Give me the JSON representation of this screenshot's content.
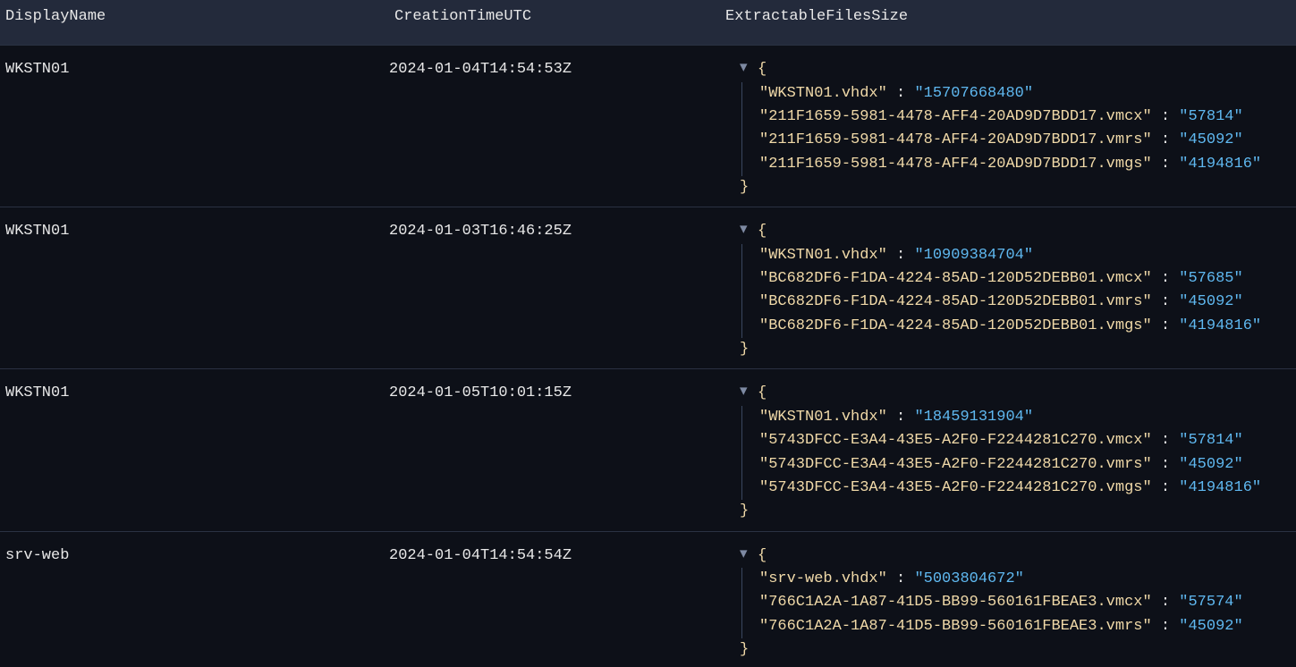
{
  "columns": {
    "displayName": "DisplayName",
    "creationTime": "CreationTimeUTC",
    "extractable": "ExtractableFilesSize"
  },
  "rows": [
    {
      "displayName": "WKSTN01",
      "creationTime": "2024-01-04T14:54:53Z",
      "files": [
        {
          "k": "WKSTN01.vhdx",
          "v": "15707668480"
        },
        {
          "k": "211F1659-5981-4478-AFF4-20AD9D7BDD17.vmcx",
          "v": "57814"
        },
        {
          "k": "211F1659-5981-4478-AFF4-20AD9D7BDD17.vmrs",
          "v": "45092"
        },
        {
          "k": "211F1659-5981-4478-AFF4-20AD9D7BDD17.vmgs",
          "v": "4194816"
        }
      ]
    },
    {
      "displayName": "WKSTN01",
      "creationTime": "2024-01-03T16:46:25Z",
      "files": [
        {
          "k": "WKSTN01.vhdx",
          "v": "10909384704"
        },
        {
          "k": "BC682DF6-F1DA-4224-85AD-120D52DEBB01.vmcx",
          "v": "57685"
        },
        {
          "k": "BC682DF6-F1DA-4224-85AD-120D52DEBB01.vmrs",
          "v": "45092"
        },
        {
          "k": "BC682DF6-F1DA-4224-85AD-120D52DEBB01.vmgs",
          "v": "4194816"
        }
      ]
    },
    {
      "displayName": "WKSTN01",
      "creationTime": "2024-01-05T10:01:15Z",
      "files": [
        {
          "k": "WKSTN01.vhdx",
          "v": "18459131904"
        },
        {
          "k": "5743DFCC-E3A4-43E5-A2F0-F2244281C270.vmcx",
          "v": "57814"
        },
        {
          "k": "5743DFCC-E3A4-43E5-A2F0-F2244281C270.vmrs",
          "v": "45092"
        },
        {
          "k": "5743DFCC-E3A4-43E5-A2F0-F2244281C270.vmgs",
          "v": "4194816"
        }
      ]
    },
    {
      "displayName": "srv-web",
      "creationTime": "2024-01-04T14:54:54Z",
      "files": [
        {
          "k": "srv-web.vhdx",
          "v": "5003804672"
        },
        {
          "k": "766C1A2A-1A87-41D5-BB99-560161FBEAE3.vmcx",
          "v": "57574"
        },
        {
          "k": "766C1A2A-1A87-41D5-BB99-560161FBEAE3.vmrs",
          "v": "45092"
        }
      ]
    }
  ],
  "glyphs": {
    "caretDown": "▾",
    "openBrace": "{",
    "closeBrace": "}",
    "quote": "\"",
    "colon": " : "
  }
}
